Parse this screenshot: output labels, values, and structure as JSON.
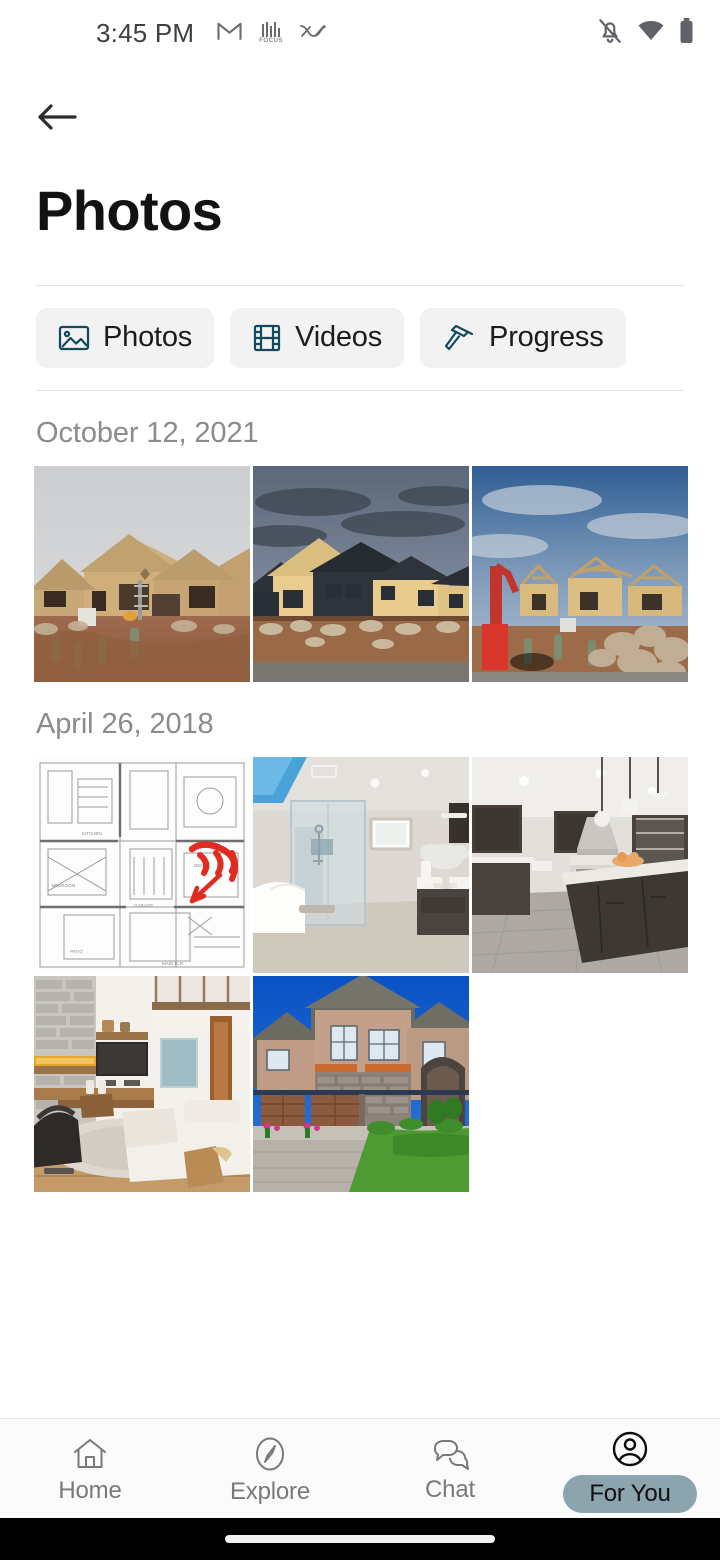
{
  "status_bar": {
    "time": "3:45 PM",
    "left_icons": [
      "gmail-icon",
      "focus-icon",
      "shuffle-icon"
    ],
    "focus_label": "FOCUS",
    "right_icons": [
      "notifications-off-icon",
      "wifi-icon",
      "battery-full-icon"
    ]
  },
  "app_bar": {
    "back_icon": "back-arrow-icon",
    "title": "Photos"
  },
  "filter_chips": [
    {
      "label": "Photos",
      "icon": "image-icon",
      "selected": true
    },
    {
      "label": "Videos",
      "icon": "film-icon",
      "selected": false
    },
    {
      "label": "Progress",
      "icon": "hammer-icon",
      "selected": false
    }
  ],
  "gallery": {
    "groups": [
      {
        "date": "October 12, 2021",
        "photos": [
          {
            "alt": "House under construction with tan sheathing under overcast sky"
          },
          {
            "alt": "Framed house with dark roof at dusk with dramatic clouds"
          },
          {
            "alt": "House framing stage with red excavator and rock pile under blue sky"
          }
        ]
      },
      {
        "date": "April 26, 2018",
        "photos": [
          {
            "alt": "Architectural floor plan blueprint with red handwritten change annotation"
          },
          {
            "alt": "Modern bathroom with glass shower enclosure and freestanding tub"
          },
          {
            "alt": "Kitchen with dark cabinetry, pendant lights and marble island"
          },
          {
            "alt": "Living room with stone fireplace, TV and white sofa"
          },
          {
            "alt": "Finished two story brick home exterior with three garage doors"
          }
        ]
      }
    ]
  },
  "bottom_nav": {
    "items": [
      {
        "label": "Home",
        "icon": "house-icon",
        "active": false
      },
      {
        "label": "Explore",
        "icon": "compass-icon",
        "active": false
      },
      {
        "label": "Chat",
        "icon": "chat-bubbles-icon",
        "active": false
      },
      {
        "label": "For You",
        "icon": "account-circle-icon",
        "active": true
      }
    ]
  },
  "colors": {
    "chip_icon": "#13495c",
    "chip_background": "#f2f2f3",
    "active_pill": "#8ba4ad",
    "date_text": "#8b8b8b",
    "title_text": "#111213"
  }
}
